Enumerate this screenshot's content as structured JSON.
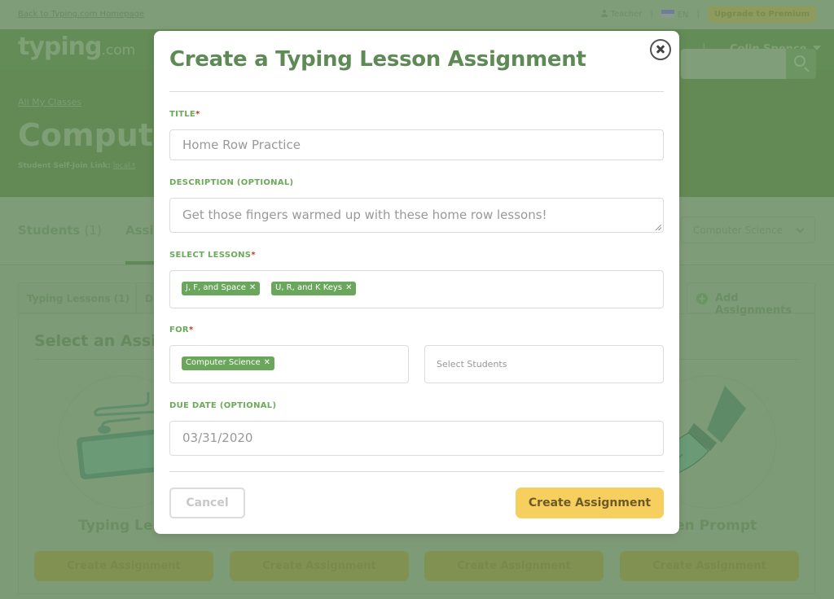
{
  "topbar": {
    "back_link": "Back to Typing.com Homepage",
    "role": "Teacher",
    "language": "EN",
    "upgrade": "Upgrade to Premium"
  },
  "navbar": {
    "logo_main": "typing",
    "logo_suffix": ".com",
    "user_name": "Colin Spence"
  },
  "hero": {
    "breadcrumb": "All My Classes",
    "class_title": "Compute",
    "self_join_label": "Student Self-Join Link:",
    "self_join_link": "local.t"
  },
  "tabs": {
    "students_label": "Students",
    "students_count": "(1)",
    "assignments_label": "Assi",
    "class_select": "Computer Science"
  },
  "subtabs": {
    "typing_lessons": "Typing Lessons (1)",
    "second": "D",
    "add_assignments": "Add Assignments"
  },
  "panel": {
    "title": "Select an Assi",
    "cards": [
      {
        "title": "Typing Less",
        "button": "Create Assignment"
      },
      {
        "title": "",
        "button": "Create Assignment"
      },
      {
        "title": "",
        "button": "Create Assignment"
      },
      {
        "title": "tten Prompt",
        "button": "Create Assignment"
      }
    ]
  },
  "modal": {
    "title": "Create a Typing Lesson Assignment",
    "title_label": "TITLE",
    "title_value": "Home Row Practice",
    "description_label": "DESCRIPTION (OPTIONAL)",
    "description_value": "Get those fingers warmed up with these home row lessons!",
    "lessons_label": "SELECT LESSONS",
    "lessons": [
      "J, F, and Space",
      "U, R, and K Keys"
    ],
    "for_label": "FOR",
    "for_class": "Computer Science",
    "students_placeholder": "Select Students",
    "due_label": "DUE DATE (OPTIONAL)",
    "due_value": "03/31/2020",
    "required_marker": "*",
    "tag_remove": "✕",
    "cancel": "Cancel",
    "create": "Create Assignment"
  },
  "colors": {
    "brand_green": "#5d8a55",
    "label_green": "#6aaa5a",
    "tag_green": "#6aa65c",
    "create_yellow": "#f6cf5e",
    "required_red": "#c0392b"
  }
}
